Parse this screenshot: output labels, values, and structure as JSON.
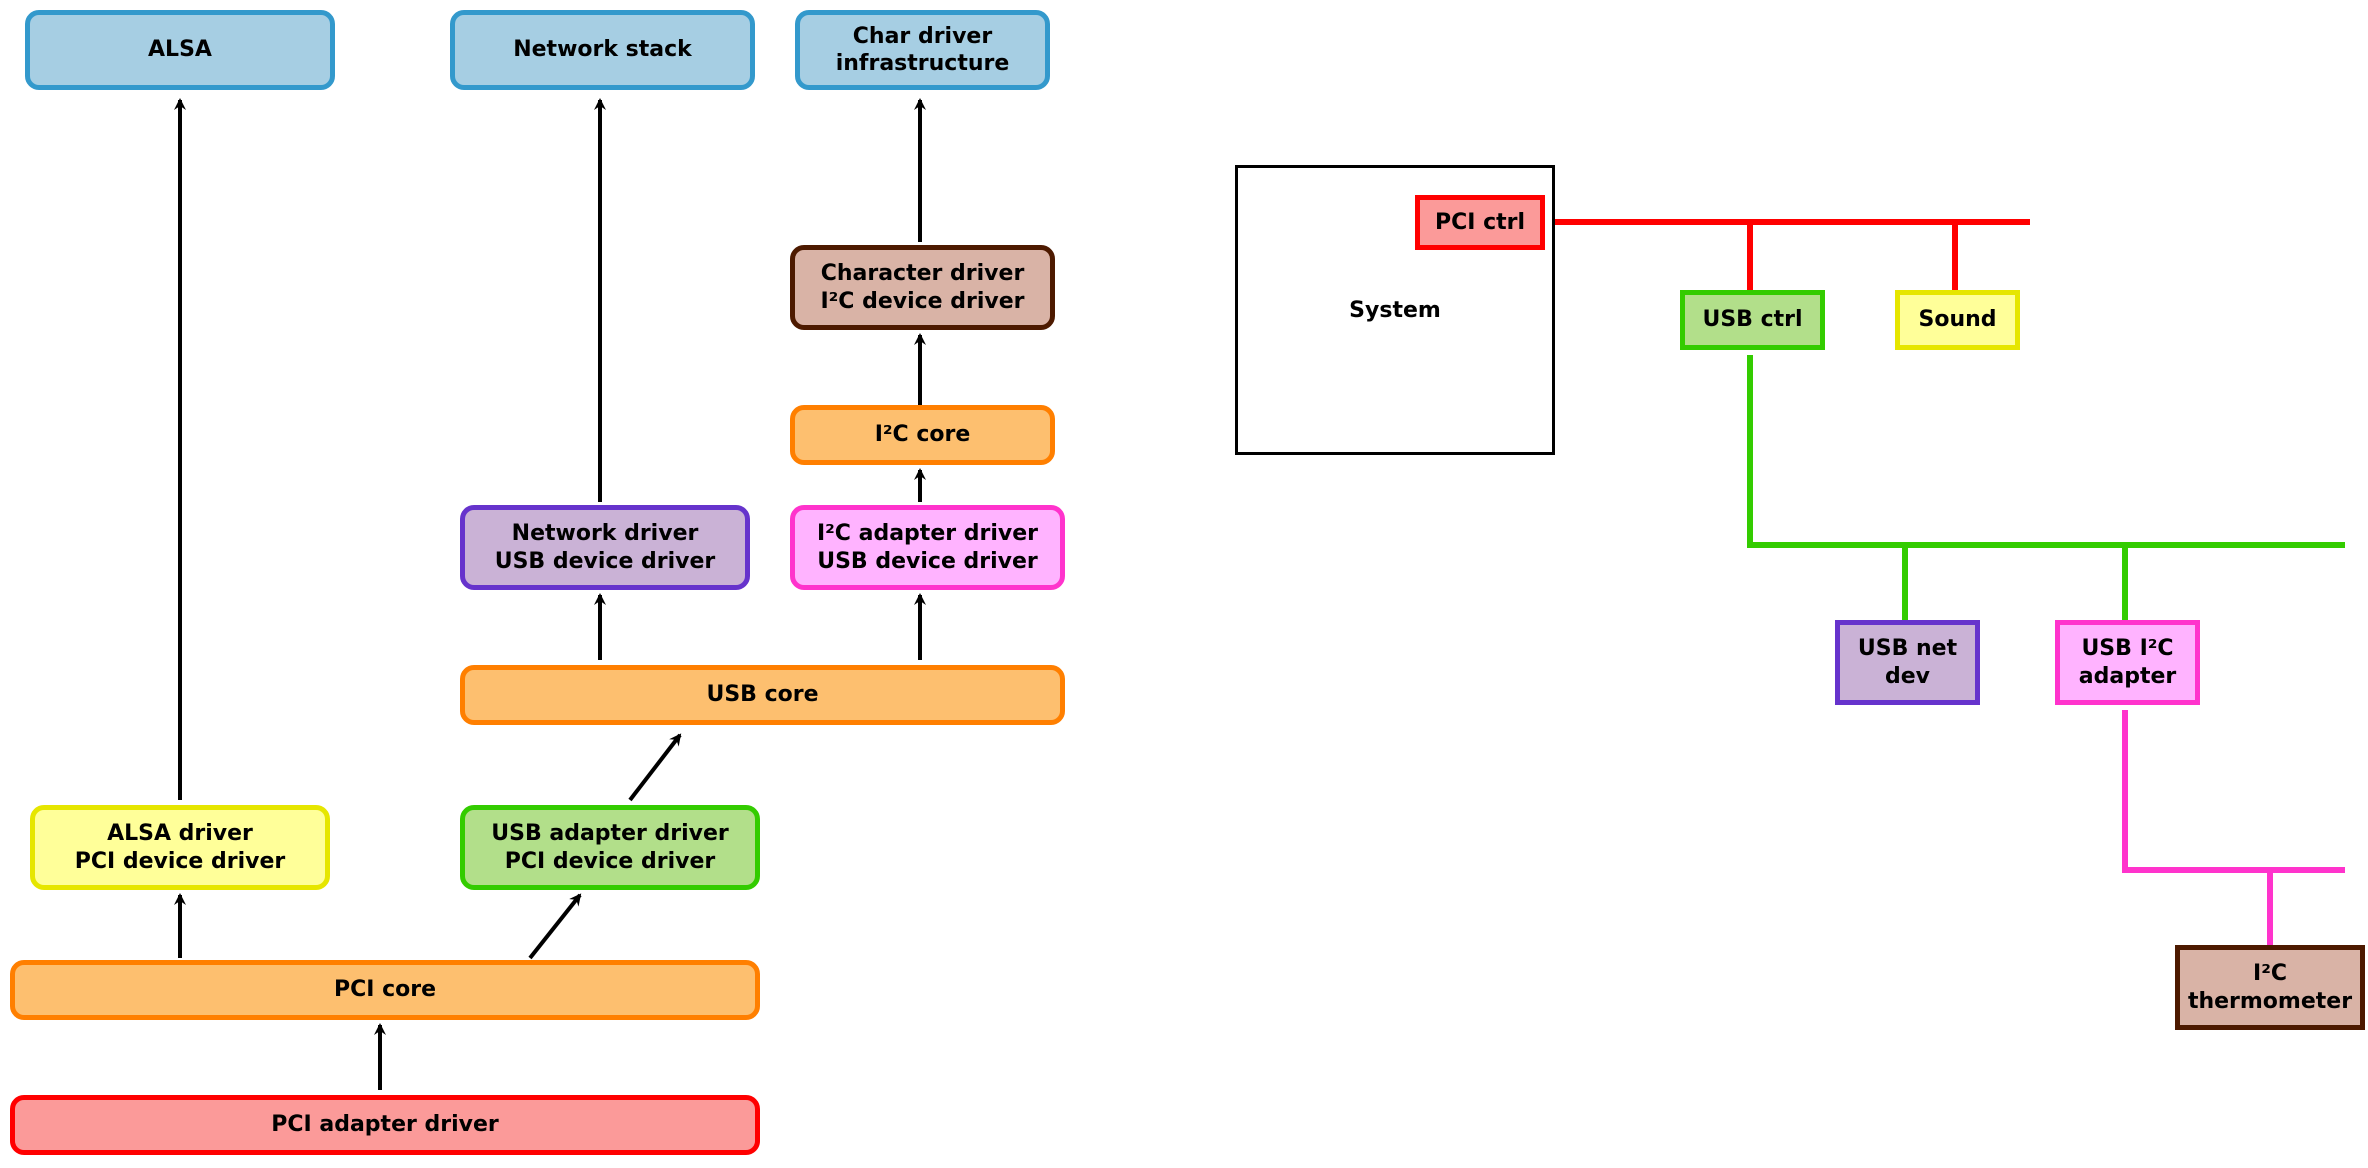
{
  "left": {
    "alsa": "ALSA",
    "netstack": "Network stack",
    "charinfra1": "Char driver",
    "charinfra2": "infrastructure",
    "chardrv1": "Character driver",
    "chardrv2": "I²C device driver",
    "i2ccore": "I²C core",
    "netdrv1": "Network driver",
    "netdrv2": "USB device driver",
    "i2cadapter1": "I²C adapter driver",
    "i2cadapter2": "USB device driver",
    "usbcore": "USB core",
    "alsadrv1": "ALSA driver",
    "alsadrv2": "PCI device driver",
    "usbadapter1": "USB adapter driver",
    "usbadapter2": "PCI device driver",
    "pcicore": "PCI core",
    "pciadapter": "PCI adapter driver"
  },
  "right": {
    "system": "System",
    "pcictrl": "PCI ctrl",
    "usbctrl": "USB ctrl",
    "sound": "Sound",
    "usbnet1": "USB net",
    "usbnet2": "dev",
    "usbi2c1": "USB I²C",
    "usbi2c2": "adapter",
    "i2ctherm1": "I²C",
    "i2ctherm2": "thermometer"
  },
  "colors": {
    "blue_fill": "#a6cee3",
    "blue_stroke": "#3399cc",
    "orange_fill": "#fdbf6f",
    "orange_stroke": "#ff7f00",
    "yellow_fill": "#ffff99",
    "yellow_stroke": "#e6e600",
    "green_fill": "#b2df8a",
    "green_stroke": "#33cc00",
    "red_fill": "#fb9a99",
    "red_stroke": "#ff0000",
    "purple_fill": "#cab2d6",
    "purple_stroke": "#6633cc",
    "magenta_fill": "#ffb3ff",
    "magenta_stroke": "#ff33cc",
    "brown_fill": "#d9b3a6",
    "brown_stroke": "#4d1a00",
    "wire_red": "#ff0000",
    "wire_green": "#33cc00",
    "wire_magenta": "#ff33cc"
  }
}
